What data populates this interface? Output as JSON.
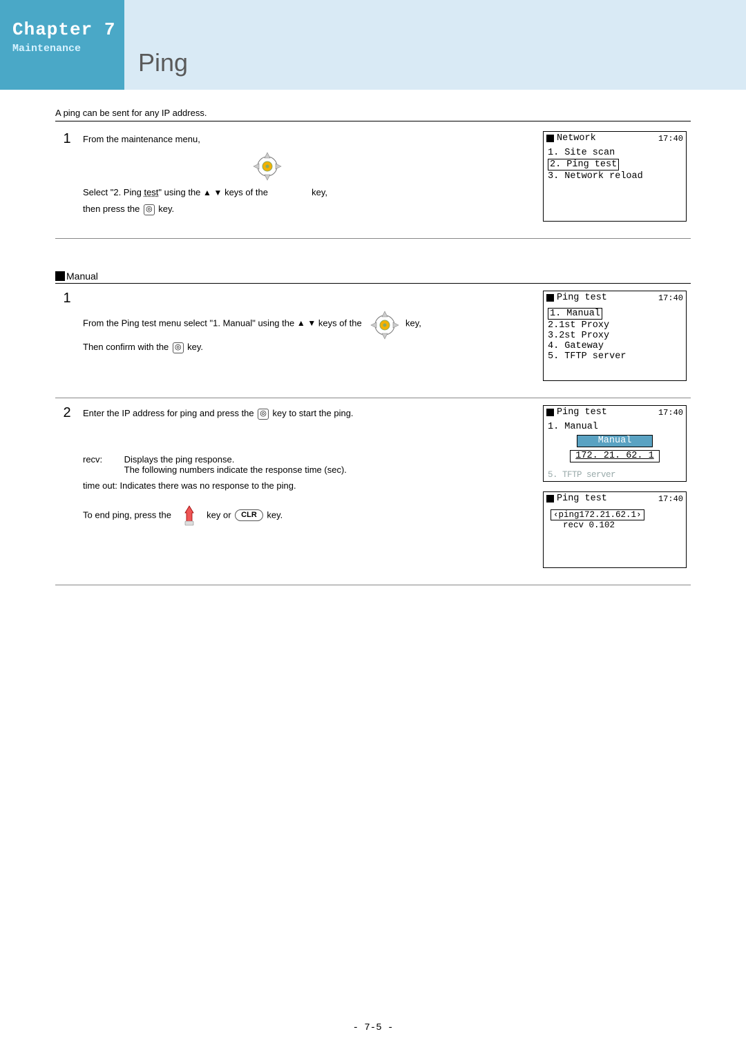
{
  "header": {
    "chapter": "Chapter 7",
    "subtitle": "Maintenance",
    "title": "Ping"
  },
  "intro": "A ping can be sent for any IP address.",
  "step1": {
    "num": "1",
    "line1": "From the maintenance menu,",
    "line2a": "Select \"2. Ping ",
    "line2_underlined": "test",
    "line2b": "\"  using the ",
    "line2c": " keys of the ",
    "line2d": " key,",
    "line3a": "then press the ",
    "line3b": " key.",
    "enter_symbol": "◎"
  },
  "screen_network": {
    "title": "Network",
    "time": "17:40",
    "items": [
      "1. Site scan",
      "2. Ping test",
      "3. Network reload"
    ],
    "boxed_index": 1
  },
  "manual_header": "Manual",
  "manual_step1": {
    "num": "1",
    "line1a": "From the Ping test menu select \"1. Manual\" using the ",
    "line1b": " keys of the ",
    "line1c": " key,",
    "line2a": "Then confirm with the ",
    "line2b": " key.",
    "enter_symbol": "◎"
  },
  "screen_pingmenu": {
    "title": "Ping test",
    "time": "17:40",
    "items": [
      "1. Manual",
      "2.1st Proxy",
      "3.2st Proxy",
      "4. Gateway",
      "5. TFTP server"
    ],
    "boxed_index": 0
  },
  "manual_step2": {
    "num": "2",
    "text_a": "Enter the IP address for ping and press the ",
    "text_b": " key to start the ping.",
    "enter_symbol": "◎",
    "recv_label": "recv:",
    "recv_desc1": "Displays the ping response.",
    "recv_desc2": "The following numbers indicate the response time (sec).",
    "timeout_label": "time out:",
    "timeout_desc": " Indicates there was no response to the ping.",
    "end_a": "To end ping, press the ",
    "end_b": " key or ",
    "end_c": " key.",
    "clr_label": "CLR"
  },
  "screen_manual_entry": {
    "title": "Ping test",
    "time": "17:40",
    "top_row": "1. Manual",
    "box_label": "Manual",
    "ip": "172. 21. 62. 1",
    "ghost": "5. TFTP server"
  },
  "screen_ping_result": {
    "title": "Ping test",
    "time": "17:40",
    "ping_line": "ping172.21.62.1",
    "recv_line": "recv  0.102"
  },
  "page_number": "- 7-5 -"
}
